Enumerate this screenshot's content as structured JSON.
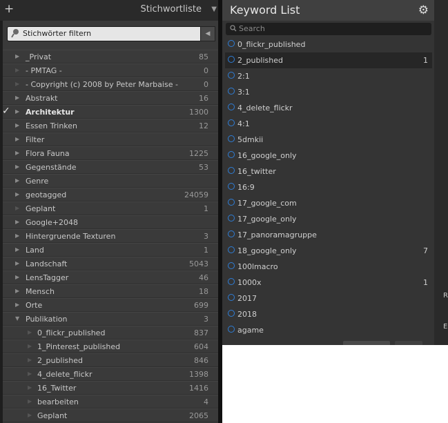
{
  "left_panel": {
    "title": "Stichwortliste",
    "add_symbol": "+",
    "filter_placeholder": "Stichwörter filtern",
    "rows": [
      {
        "label": "_Privat",
        "count": "85",
        "expandable": true,
        "checked": false,
        "sub": false
      },
      {
        "label": "-  PMTAG  -",
        "count": "0",
        "expandable": false,
        "checked": false,
        "sub": false
      },
      {
        "label": "- Copyright (c) 2008 by Peter Marbaise -",
        "count": "0",
        "expandable": false,
        "checked": false,
        "sub": false
      },
      {
        "label": "Abstrakt",
        "count": "16",
        "expandable": true,
        "checked": false,
        "sub": false
      },
      {
        "label": "Architektur",
        "count": "1300",
        "expandable": true,
        "checked": true,
        "sub": false
      },
      {
        "label": "Essen Trinken",
        "count": "12",
        "expandable": true,
        "checked": false,
        "sub": false
      },
      {
        "label": "Filter",
        "count": "",
        "expandable": true,
        "checked": false,
        "sub": false
      },
      {
        "label": "Flora Fauna",
        "count": "1225",
        "expandable": true,
        "checked": false,
        "sub": false
      },
      {
        "label": "Gegenstände",
        "count": "53",
        "expandable": true,
        "checked": false,
        "sub": false
      },
      {
        "label": "Genre",
        "count": "",
        "expandable": true,
        "checked": false,
        "sub": false
      },
      {
        "label": "geotagged",
        "count": "24059",
        "expandable": true,
        "checked": false,
        "sub": false
      },
      {
        "label": "Geplant",
        "count": "1",
        "expandable": false,
        "checked": false,
        "sub": false
      },
      {
        "label": "Google+2048",
        "count": "",
        "expandable": true,
        "checked": false,
        "sub": false
      },
      {
        "label": "Hintergruende Texturen",
        "count": "3",
        "expandable": true,
        "checked": false,
        "sub": false
      },
      {
        "label": "Land",
        "count": "1",
        "expandable": true,
        "checked": false,
        "sub": false
      },
      {
        "label": "Landschaft",
        "count": "5043",
        "expandable": true,
        "checked": false,
        "sub": false
      },
      {
        "label": "LensTagger",
        "count": "46",
        "expandable": true,
        "checked": false,
        "sub": false
      },
      {
        "label": "Mensch",
        "count": "18",
        "expandable": true,
        "checked": false,
        "sub": false
      },
      {
        "label": "Orte",
        "count": "699",
        "expandable": true,
        "checked": false,
        "sub": false
      },
      {
        "label": "Publikation",
        "count": "3",
        "expandable": true,
        "expanded": true,
        "checked": false,
        "sub": false
      },
      {
        "label": "0_flickr_published",
        "count": "837",
        "expandable": false,
        "checked": false,
        "sub": true
      },
      {
        "label": "1_Pinterest_published",
        "count": "604",
        "expandable": false,
        "checked": false,
        "sub": true
      },
      {
        "label": "2_published",
        "count": "846",
        "expandable": false,
        "checked": false,
        "sub": true
      },
      {
        "label": "4_delete_flickr",
        "count": "1398",
        "expandable": false,
        "checked": false,
        "sub": true
      },
      {
        "label": "16_Twitter",
        "count": "1416",
        "expandable": false,
        "checked": false,
        "sub": true
      },
      {
        "label": "bearbeiten",
        "count": "4",
        "expandable": false,
        "checked": false,
        "sub": true
      },
      {
        "label": "Geplant",
        "count": "2065",
        "expandable": false,
        "checked": false,
        "sub": true
      }
    ]
  },
  "right_panel": {
    "title": "Keyword List",
    "search_placeholder": "Search",
    "rows": [
      {
        "label": "0_flickr_published",
        "count": "",
        "selected": false
      },
      {
        "label": "2_published",
        "count": "1",
        "selected": true
      },
      {
        "label": "2:1",
        "count": "",
        "selected": false
      },
      {
        "label": "3:1",
        "count": "",
        "selected": false
      },
      {
        "label": "4_delete_flickr",
        "count": "",
        "selected": false
      },
      {
        "label": "4:1",
        "count": "",
        "selected": false
      },
      {
        "label": "5dmkii",
        "count": "",
        "selected": false
      },
      {
        "label": "16_google_only",
        "count": "",
        "selected": false
      },
      {
        "label": "16_twitter",
        "count": "",
        "selected": false
      },
      {
        "label": "16:9",
        "count": "",
        "selected": false
      },
      {
        "label": "17_google_com",
        "count": "",
        "selected": false
      },
      {
        "label": "17_google_only",
        "count": "",
        "selected": false
      },
      {
        "label": "17_panoramagruppe",
        "count": "",
        "selected": false
      },
      {
        "label": "18_google_only",
        "count": "7",
        "selected": false
      },
      {
        "label": "100lmacro",
        "count": "",
        "selected": false
      },
      {
        "label": "1000x",
        "count": "1",
        "selected": false
      },
      {
        "label": "2017",
        "count": "",
        "selected": false
      },
      {
        "label": "2018",
        "count": "",
        "selected": false
      },
      {
        "label": "agame",
        "count": "",
        "selected": false
      }
    ],
    "side_letters": [
      "R",
      "E"
    ],
    "colors": {
      "accent": "#2e7ed8"
    }
  }
}
